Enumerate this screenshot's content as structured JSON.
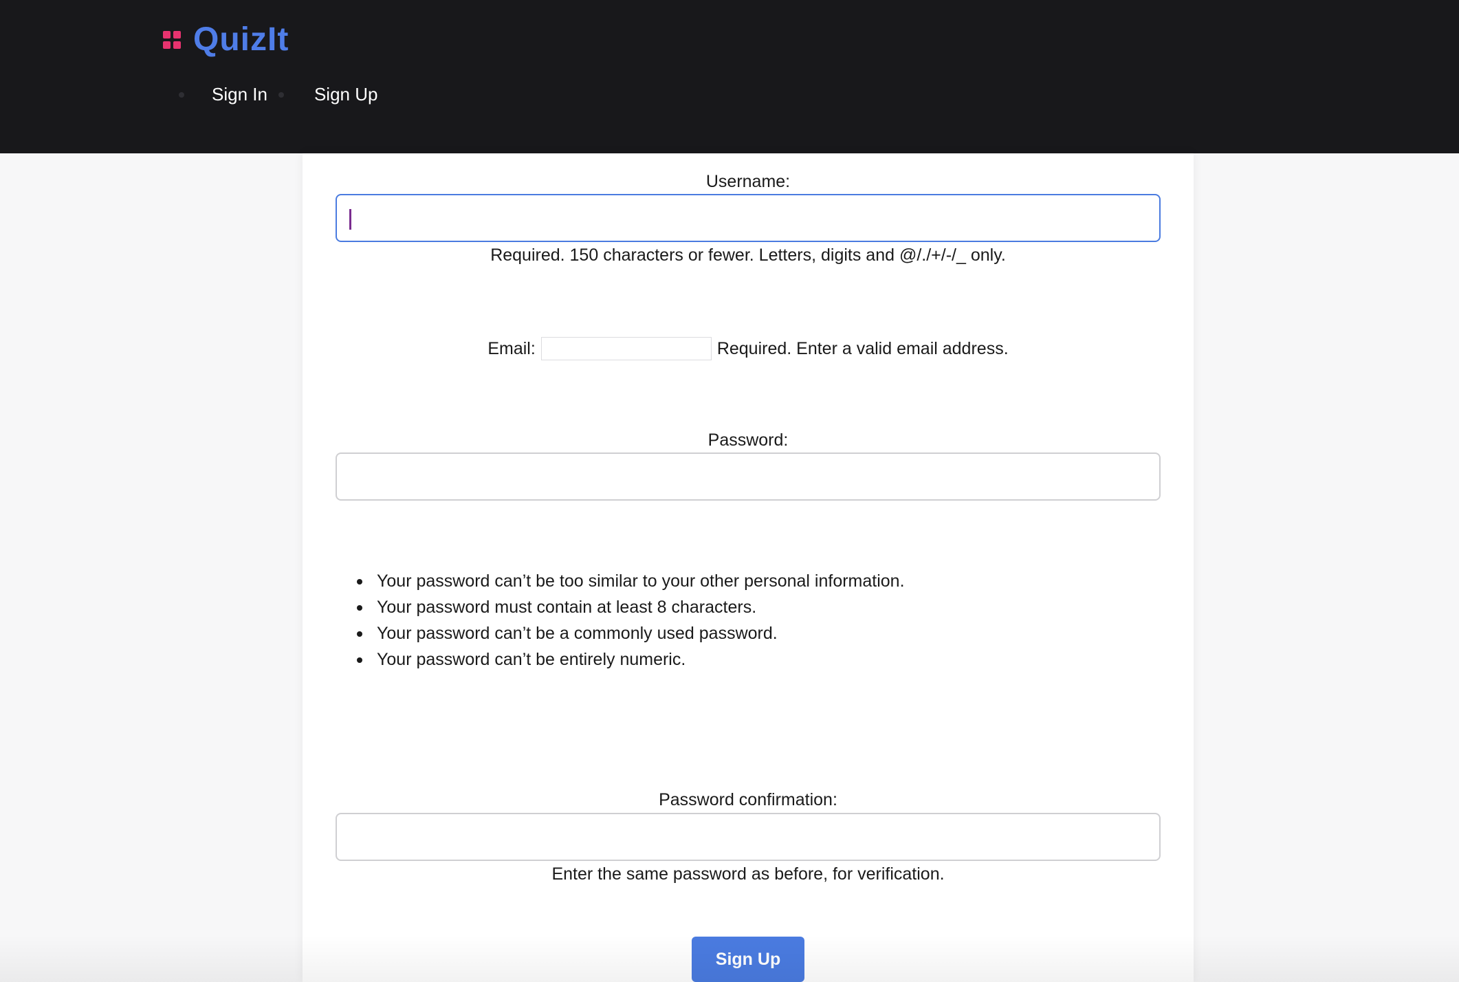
{
  "header": {
    "brand": "QuizIt",
    "brand_color": "#4f7de8",
    "logo_color": "#e7336f",
    "nav": [
      {
        "label": "Sign In"
      },
      {
        "label": "Sign Up"
      }
    ]
  },
  "form": {
    "username": {
      "label": "Username:",
      "value": "",
      "help": "Required. 150 characters or fewer. Letters, digits and @/./+/-/_ only."
    },
    "email": {
      "label": "Email:",
      "value": "",
      "help": "Required. Enter a valid email address."
    },
    "password": {
      "label": "Password:",
      "value": "",
      "rules": [
        "Your password can’t be too similar to your other personal information.",
        "Your password must contain at least 8 characters.",
        "Your password can’t be a commonly used password.",
        "Your password can’t be entirely numeric."
      ]
    },
    "password_confirmation": {
      "label": "Password confirmation:",
      "value": "",
      "help": "Enter the same password as before, for verification."
    },
    "submit_label": "Sign Up",
    "accent_color": "#4a7be0"
  }
}
